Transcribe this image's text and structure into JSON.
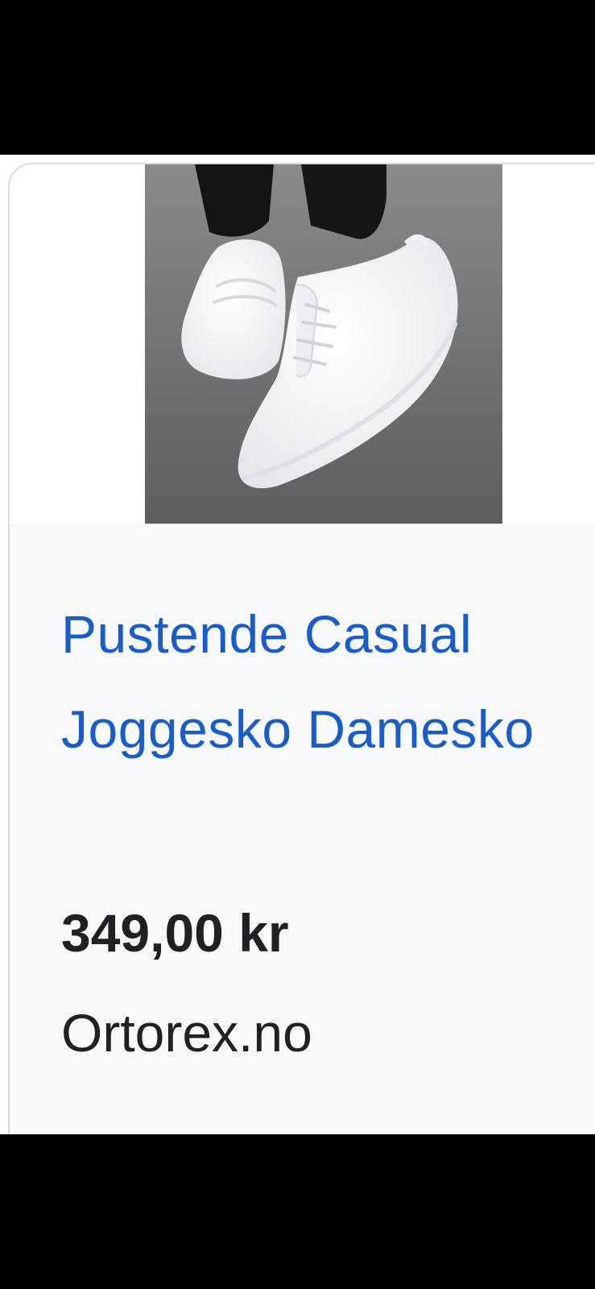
{
  "product": {
    "image_alt": "White knit sneakers on asphalt",
    "title": "Pustende Casual Joggesko Damesko",
    "price": "349,00 kr",
    "merchant": "Ortorex.no"
  },
  "colors": {
    "title_link": "#1a5cc8",
    "text": "#202124",
    "card_border": "#dadce0",
    "info_background": "#f8f9fa"
  }
}
